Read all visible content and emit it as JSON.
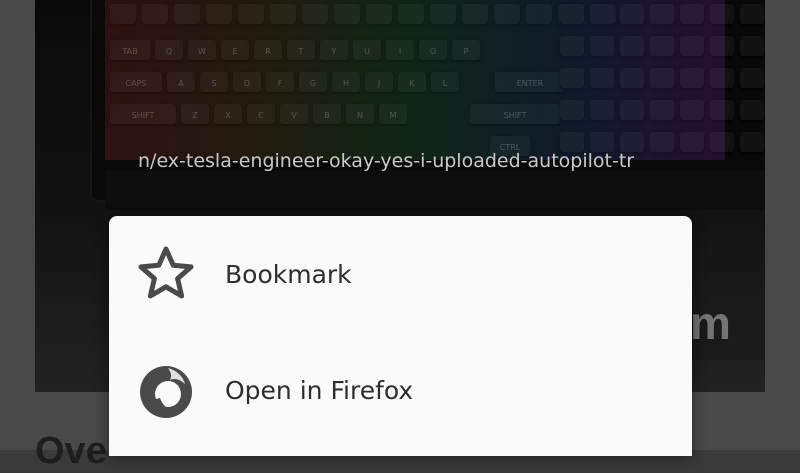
{
  "background": {
    "url_text": "n/ex-tesla-engineer-okay-yes-i-uploaded-autopilot-tr",
    "brand_fragment": "m",
    "article_fragment": "Ove"
  },
  "keyboard": {
    "row1": [
      "TAB",
      "Q",
      "W",
      "E",
      "R",
      "T",
      "Y",
      "U",
      "I",
      "O",
      "P"
    ],
    "row2": [
      "CAPS",
      "A",
      "S",
      "D",
      "F",
      "G",
      "H",
      "J",
      "K",
      "L"
    ],
    "row3": [
      "SHIFT",
      "Z",
      "X",
      "C",
      "V",
      "B",
      "N",
      "M"
    ],
    "right_labels": [
      "ENTER",
      "SHIFT",
      "CTRL"
    ]
  },
  "menu": {
    "items": [
      {
        "label": "Bookmark",
        "icon": "star-outline-icon"
      },
      {
        "label": "Open in Firefox",
        "icon": "firefox-icon"
      }
    ]
  },
  "colors": {
    "menu_bg": "#fafafa",
    "icon": "#4a4a4a",
    "text": "#2e2e2e"
  }
}
